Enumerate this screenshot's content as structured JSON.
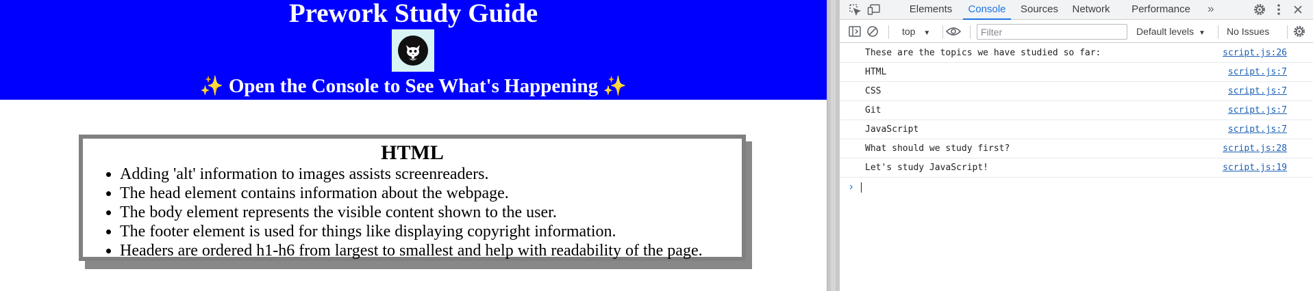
{
  "page": {
    "title": "Prework Study Guide",
    "subtitle": "Open the Console to See What's Happening",
    "sparkle": "✨",
    "hero_color": "#0000ff",
    "logo_icon": "cat-avatar-icon",
    "card": {
      "title": "HTML",
      "items": [
        "Adding 'alt' information to images assists screenreaders.",
        "The head element contains information about the webpage.",
        "The body element represents the visible content shown to the user.",
        "The footer element is used for things like displaying copyright information.",
        "Headers are ordered h1-h6 from largest to smallest and help with readability of the page."
      ]
    }
  },
  "devtools": {
    "tabs": [
      {
        "label": "Elements",
        "active": false
      },
      {
        "label": "Console",
        "active": true
      },
      {
        "label": "Sources",
        "active": false
      },
      {
        "label": "Network",
        "active": false
      },
      {
        "label": "Performance",
        "active": false
      }
    ],
    "more_tabs": "»",
    "accent_color": "#1a73e8",
    "toolbar": {
      "context": "top",
      "filter_placeholder": "Filter",
      "levels": "Default levels",
      "issues": "No Issues"
    },
    "logs": [
      {
        "message": "These are the topics we have studied so far:",
        "source": "script.js:26"
      },
      {
        "message": "HTML",
        "source": "script.js:7"
      },
      {
        "message": "CSS",
        "source": "script.js:7"
      },
      {
        "message": "Git",
        "source": "script.js:7"
      },
      {
        "message": "JavaScript",
        "source": "script.js:7"
      },
      {
        "message": "What should we study first?",
        "source": "script.js:28"
      },
      {
        "message": "Let's study JavaScript!",
        "source": "script.js:19"
      }
    ],
    "prompt_symbol": "›"
  }
}
